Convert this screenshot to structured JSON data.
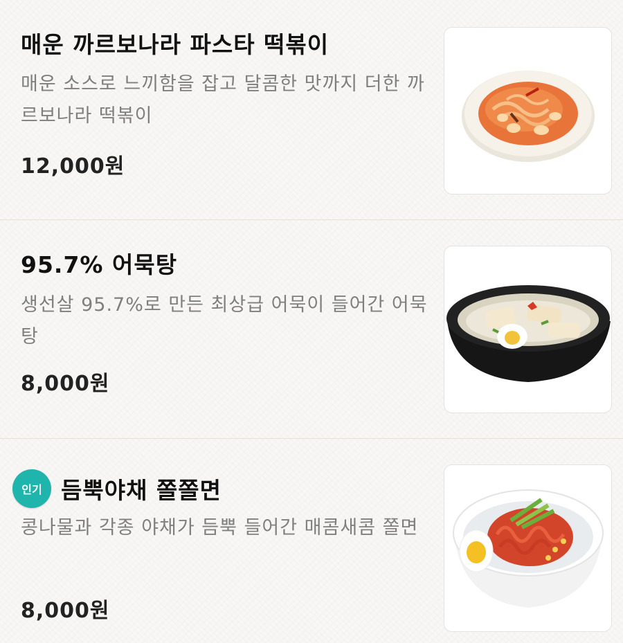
{
  "menu": {
    "items": [
      {
        "title": "매운 까르보나라 파스타 떡볶이",
        "description": "매운 소스로 느끼함을 잡고 달콤한 맛까지 더한 까르보나라 떡볶이",
        "price": "12,000원",
        "image_icon": "spicy-carbonara-tteokbokki-dish"
      },
      {
        "title": "95.7% 어묵탕",
        "description": "생선살 95.7%로 만든 최상급 어묵이 들어간 어묵탕",
        "price": "8,000원",
        "image_icon": "fishcake-soup-bowl"
      },
      {
        "badge": "인기",
        "title": "듬뿍야채 쫄쫄면",
        "description": "콩나물과 각종 야채가 듬뿍 들어간 매콤새콤 쫄면",
        "price": "8,000원",
        "image_icon": "jjolmyeon-noodle-bowl"
      }
    ]
  },
  "colors": {
    "badge": "#1fb5ad",
    "description": "#7f7f7f",
    "divider": "#e6dfd4"
  }
}
